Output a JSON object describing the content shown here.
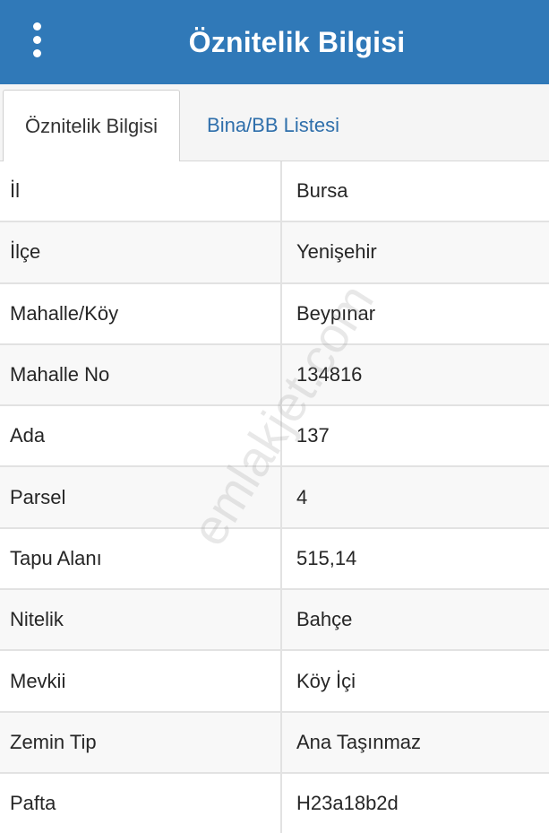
{
  "header": {
    "title": "Öznitelik Bilgisi",
    "menu_icon": "more-vertical-icon"
  },
  "tabs": [
    {
      "label": "Öznitelik Bilgisi",
      "active": true
    },
    {
      "label": "Bina/BB Listesi",
      "active": false
    }
  ],
  "attributes": [
    {
      "key": "İl",
      "value": "Bursa"
    },
    {
      "key": "İlçe",
      "value": "Yenişehir"
    },
    {
      "key": "Mahalle/Köy",
      "value": "Beypınar"
    },
    {
      "key": "Mahalle No",
      "value": "134816"
    },
    {
      "key": "Ada",
      "value": "137"
    },
    {
      "key": "Parsel",
      "value": "4"
    },
    {
      "key": "Tapu Alanı",
      "value": "515,14"
    },
    {
      "key": "Nitelik",
      "value": "Bahçe"
    },
    {
      "key": "Mevkii",
      "value": "Köy İçi"
    },
    {
      "key": "Zemin Tip",
      "value": "Ana Taşınmaz"
    },
    {
      "key": "Pafta",
      "value": "H23a18b2d"
    }
  ],
  "watermark": "emlakjet.com",
  "colors": {
    "header_bg": "#3079b8",
    "tab_link": "#2f6fab"
  }
}
